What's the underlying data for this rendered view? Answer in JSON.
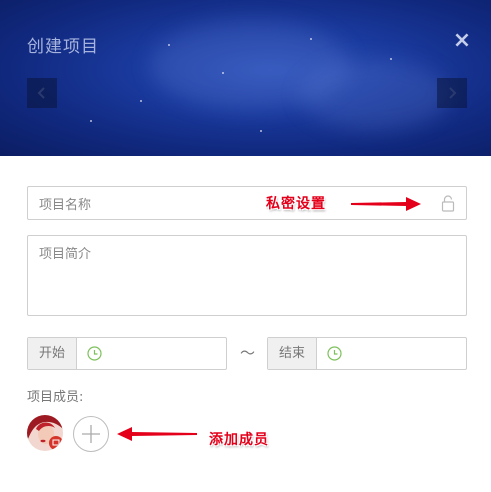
{
  "header": {
    "title": "创建项目",
    "close_icon": "×"
  },
  "form": {
    "name_placeholder": "项目名称",
    "desc_placeholder": "项目简介",
    "start_label": "开始",
    "end_label": "结束",
    "range_separator": "～",
    "members_label": "项目成员:"
  },
  "annotations": {
    "private_setting": "私密设置",
    "add_member": "添加成员"
  },
  "colors": {
    "banner": "#10287d",
    "annotation": "#e4001a",
    "clock": "#7cc05a"
  }
}
